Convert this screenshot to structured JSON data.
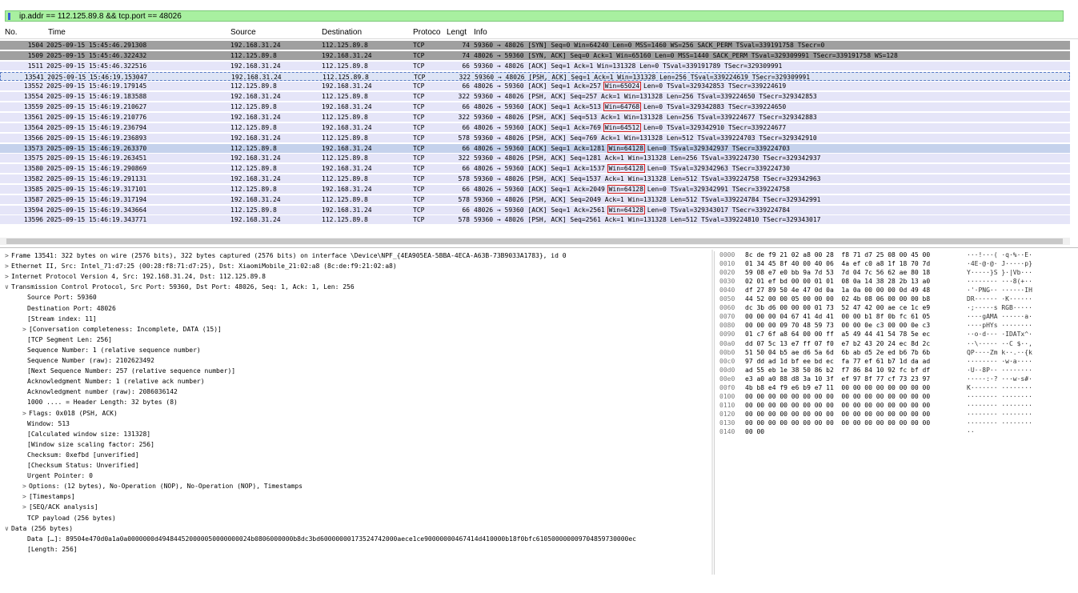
{
  "filter": {
    "value": "ip.addr == 112.125.89.8 && tcp.port == 48026"
  },
  "columns": [
    "No.",
    "Time",
    "Source",
    "Destination",
    "Protoco",
    "Lengt",
    "Info"
  ],
  "packets": [
    {
      "no": "1504",
      "time": "2025-09-15 15:45:46.291308",
      "src": "192.168.31.24",
      "dst": "112.125.89.8",
      "proto": "TCP",
      "len": "74",
      "info_pre": "59360 → 48026 [SYN] Seq=0 Win=64240 Len=0 MSS=1460 WS=256 SACK_PERM TSval=339191758 TSecr=0",
      "win": "",
      "info_post": "",
      "style": "gray"
    },
    {
      "no": "1509",
      "time": "2025-09-15 15:45:46.322432",
      "src": "112.125.89.8",
      "dst": "192.168.31.24",
      "proto": "TCP",
      "len": "74",
      "info_pre": "48026 → 59360 [SYN, ACK] Seq=0 Ack=1 Win=65160 Len=0 MSS=1440 SACK_PERM TSval=329309991 TSecr=339191758 WS=128",
      "win": "",
      "info_post": "",
      "style": "gray"
    },
    {
      "no": "1511",
      "time": "2025-09-15 15:45:46.322516",
      "src": "192.168.31.24",
      "dst": "112.125.89.8",
      "proto": "TCP",
      "len": "66",
      "info_pre": "59360 → 48026 [ACK] Seq=1 Ack=1 Win=131328 Len=0 TSval=339191789 TSecr=329309991",
      "win": "",
      "info_post": "",
      "style": "lav"
    },
    {
      "no": "13541",
      "time": "2025-09-15 15:46:19.153047",
      "src": "192.168.31.24",
      "dst": "112.125.89.8",
      "proto": "TCP",
      "len": "322",
      "info_pre": "59360 → 48026 [PSH, ACK] Seq=1 Ack=1 Win=131328 Len=256 TSval=339224619 TSecr=329309991",
      "win": "",
      "info_post": "",
      "style": "cur"
    },
    {
      "no": "13552",
      "time": "2025-09-15 15:46:19.179145",
      "src": "112.125.89.8",
      "dst": "192.168.31.24",
      "proto": "TCP",
      "len": "66",
      "info_pre": "48026 → 59360 [ACK] Seq=1 Ack=257 ",
      "win": "Win=65024",
      "info_post": " Len=0 TSval=329342853 TSecr=339224619",
      "style": "lav"
    },
    {
      "no": "13554",
      "time": "2025-09-15 15:46:19.183588",
      "src": "192.168.31.24",
      "dst": "112.125.89.8",
      "proto": "TCP",
      "len": "322",
      "info_pre": "59360 → 48026 [PSH, ACK] Seq=257 Ack=1 Win=131328 Len=256 TSval=339224650 TSecr=329342853",
      "win": "",
      "info_post": "",
      "style": "lav"
    },
    {
      "no": "13559",
      "time": "2025-09-15 15:46:19.210627",
      "src": "112.125.89.8",
      "dst": "192.168.31.24",
      "proto": "TCP",
      "len": "66",
      "info_pre": "48026 → 59360 [ACK] Seq=1 Ack=513 ",
      "win": "Win=64768",
      "info_post": " Len=0 TSval=329342883 TSecr=339224650",
      "style": "lav"
    },
    {
      "no": "13561",
      "time": "2025-09-15 15:46:19.210776",
      "src": "192.168.31.24",
      "dst": "112.125.89.8",
      "proto": "TCP",
      "len": "322",
      "info_pre": "59360 → 48026 [PSH, ACK] Seq=513 Ack=1 Win=131328 Len=256 TSval=339224677 TSecr=329342883",
      "win": "",
      "info_post": "",
      "style": "lav"
    },
    {
      "no": "13564",
      "time": "2025-09-15 15:46:19.236794",
      "src": "112.125.89.8",
      "dst": "192.168.31.24",
      "proto": "TCP",
      "len": "66",
      "info_pre": "48026 → 59360 [ACK] Seq=1 Ack=769 ",
      "win": "Win=64512",
      "info_post": " Len=0 TSval=329342910 TSecr=339224677",
      "style": "lav"
    },
    {
      "no": "13566",
      "time": "2025-09-15 15:46:19.236893",
      "src": "192.168.31.24",
      "dst": "112.125.89.8",
      "proto": "TCP",
      "len": "578",
      "info_pre": "59360 → 48026 [PSH, ACK] Seq=769 Ack=1 Win=131328 Len=512 TSval=339224703 TSecr=329342910",
      "win": "",
      "info_post": "",
      "style": "lav"
    },
    {
      "no": "13573",
      "time": "2025-09-15 15:46:19.263370",
      "src": "112.125.89.8",
      "dst": "192.168.31.24",
      "proto": "TCP",
      "len": "66",
      "info_pre": "48026 → 59360 [ACK] Seq=1 Ack=1281 ",
      "win": "Win=64128",
      "info_post": " Len=0 TSval=329342937 TSecr=339224703",
      "style": "sel"
    },
    {
      "no": "13575",
      "time": "2025-09-15 15:46:19.263451",
      "src": "192.168.31.24",
      "dst": "112.125.89.8",
      "proto": "TCP",
      "len": "322",
      "info_pre": "59360 → 48026 [PSH, ACK] Seq=1281 Ack=1 Win=131328 Len=256 TSval=339224730 TSecr=329342937",
      "win": "",
      "info_post": "",
      "style": "lav"
    },
    {
      "no": "13580",
      "time": "2025-09-15 15:46:19.290869",
      "src": "112.125.89.8",
      "dst": "192.168.31.24",
      "proto": "TCP",
      "len": "66",
      "info_pre": "48026 → 59360 [ACK] Seq=1 Ack=1537 ",
      "win": "Win=64128",
      "info_post": " Len=0 TSval=329342963 TSecr=339224730",
      "style": "lav"
    },
    {
      "no": "13582",
      "time": "2025-09-15 15:46:19.291131",
      "src": "192.168.31.24",
      "dst": "112.125.89.8",
      "proto": "TCP",
      "len": "578",
      "info_pre": "59360 → 48026 [PSH, ACK] Seq=1537 Ack=1 Win=131328 Len=512 TSval=339224758 TSecr=329342963",
      "win": "",
      "info_post": "",
      "style": "lav"
    },
    {
      "no": "13585",
      "time": "2025-09-15 15:46:19.317101",
      "src": "112.125.89.8",
      "dst": "192.168.31.24",
      "proto": "TCP",
      "len": "66",
      "info_pre": "48026 → 59360 [ACK] Seq=1 Ack=2049 ",
      "win": "Win=64128",
      "info_post": " Len=0 TSval=329342991 TSecr=339224758",
      "style": "lav"
    },
    {
      "no": "13587",
      "time": "2025-09-15 15:46:19.317194",
      "src": "192.168.31.24",
      "dst": "112.125.89.8",
      "proto": "TCP",
      "len": "578",
      "info_pre": "59360 → 48026 [PSH, ACK] Seq=2049 Ack=1 Win=131328 Len=512 TSval=339224784 TSecr=329342991",
      "win": "",
      "info_post": "",
      "style": "lav"
    },
    {
      "no": "13594",
      "time": "2025-09-15 15:46:19.343664",
      "src": "112.125.89.8",
      "dst": "192.168.31.24",
      "proto": "TCP",
      "len": "66",
      "info_pre": "48026 → 59360 [ACK] Seq=1 Ack=2561 ",
      "win": "Win=64128",
      "info_post": " Len=0 TSval=329343017 TSecr=339224784",
      "style": "lav"
    },
    {
      "no": "13596",
      "time": "2025-09-15 15:46:19.343771",
      "src": "192.168.31.24",
      "dst": "112.125.89.8",
      "proto": "TCP",
      "len": "578",
      "info_pre": "59360 → 48026 [PSH, ACK] Seq=2561 Ack=1 Win=131328 Len=512 TSval=339224810 TSecr=329343017",
      "win": "",
      "info_post": "",
      "style": "lav"
    }
  ],
  "details": [
    {
      "arrow": ">",
      "indent": 0,
      "text": "Frame 13541: 322 bytes on wire (2576 bits), 322 bytes captured (2576 bits) on interface \\Device\\NPF_{4EA905EA-5BBA-4ECA-A63B-73B9033A1783}, id 0"
    },
    {
      "arrow": ">",
      "indent": 0,
      "text": "Ethernet II, Src: Intel_71:d7:25 (00:28:f8:71:d7:25), Dst: XiaomiMobile_21:02:a8 (8c:de:f9:21:02:a8)"
    },
    {
      "arrow": ">",
      "indent": 0,
      "text": "Internet Protocol Version 4, Src: 192.168.31.24, Dst: 112.125.89.8"
    },
    {
      "arrow": "∨",
      "indent": 0,
      "text": "Transmission Control Protocol, Src Port: 59360, Dst Port: 48026, Seq: 1, Ack: 1, Len: 256"
    },
    {
      "arrow": "",
      "indent": 1,
      "text": "Source Port: 59360"
    },
    {
      "arrow": "",
      "indent": 1,
      "text": "Destination Port: 48026"
    },
    {
      "arrow": "",
      "indent": 1,
      "text": "[Stream index: 11]"
    },
    {
      "arrow": ">",
      "indent": 1,
      "text": "[Conversation completeness: Incomplete, DATA (15)]"
    },
    {
      "arrow": "",
      "indent": 1,
      "text": "[TCP Segment Len: 256]"
    },
    {
      "arrow": "",
      "indent": 1,
      "text": "Sequence Number: 1    (relative sequence number)"
    },
    {
      "arrow": "",
      "indent": 1,
      "text": "Sequence Number (raw): 2102623492"
    },
    {
      "arrow": "",
      "indent": 1,
      "text": "[Next Sequence Number: 257    (relative sequence number)]"
    },
    {
      "arrow": "",
      "indent": 1,
      "text": "Acknowledgment Number: 1    (relative ack number)"
    },
    {
      "arrow": "",
      "indent": 1,
      "text": "Acknowledgment number (raw): 2086036142"
    },
    {
      "arrow": "",
      "indent": 1,
      "text": "1000 .... = Header Length: 32 bytes (8)"
    },
    {
      "arrow": ">",
      "indent": 1,
      "text": "Flags: 0x018 (PSH, ACK)"
    },
    {
      "arrow": "",
      "indent": 1,
      "text": "Window: 513"
    },
    {
      "arrow": "",
      "indent": 1,
      "text": "[Calculated window size: 131328]"
    },
    {
      "arrow": "",
      "indent": 1,
      "text": "[Window size scaling factor: 256]"
    },
    {
      "arrow": "",
      "indent": 1,
      "text": "Checksum: 0xefbd [unverified]"
    },
    {
      "arrow": "",
      "indent": 1,
      "text": "[Checksum Status: Unverified]"
    },
    {
      "arrow": "",
      "indent": 1,
      "text": "Urgent Pointer: 0"
    },
    {
      "arrow": ">",
      "indent": 1,
      "text": "Options: (12 bytes), No-Operation (NOP), No-Operation (NOP), Timestamps"
    },
    {
      "arrow": ">",
      "indent": 1,
      "text": "[Timestamps]"
    },
    {
      "arrow": ">",
      "indent": 1,
      "text": "[SEQ/ACK analysis]"
    },
    {
      "arrow": "",
      "indent": 1,
      "text": "TCP payload (256 bytes)"
    },
    {
      "arrow": "∨",
      "indent": 0,
      "text": "Data (256 bytes)"
    },
    {
      "arrow": "",
      "indent": 1,
      "text": "Data […]: 89504e470d0a1a0a0000000d494844520000050000000024b0806000000b8dc3bd60000000173524742000aece1ce90000000467414d410000b18f0bfc610500000009704859730000ec"
    },
    {
      "arrow": "",
      "indent": 1,
      "text": "[Length: 256]"
    }
  ],
  "hex": [
    {
      "off": "0000",
      "hx": "8c de f9 21 02 a8 00 28  f8 71 d7 25 08 00 45 00",
      "asc": "···!···( ·q·%··E·"
    },
    {
      "off": "0010",
      "hx": "01 34 45 8f 40 00 40 06  4a ef c0 a8 1f 18 70 7d",
      "asc": "·4E·@·@· J·····p}"
    },
    {
      "off": "0020",
      "hx": "59 08 e7 e0 bb 9a 7d 53  7d 04 7c 56 62 ae 80 18",
      "asc": "Y·····}S }·|Vb···"
    },
    {
      "off": "0030",
      "hx": "02 01 ef bd 00 00 01 01  08 0a 14 38 28 2b 13 a0",
      "asc": "········ ···8(+··"
    },
    {
      "off": "0040",
      "hx": "df 27 89 50 4e 47 0d 0a  1a 0a 00 00 00 0d 49 48",
      "asc": "·'·PNG·· ······IH"
    },
    {
      "off": "0050",
      "hx": "44 52 00 00 05 00 00 00  02 4b 08 06 00 00 00 b8",
      "asc": "DR······ ·K······"
    },
    {
      "off": "0060",
      "hx": "dc 3b d6 00 00 00 01 73  52 47 42 00 ae ce 1c e9",
      "asc": "·;·····s RGB·····"
    },
    {
      "off": "0070",
      "hx": "00 00 00 04 67 41 4d 41  00 00 b1 8f 0b fc 61 05",
      "asc": "····gAMA ······a·"
    },
    {
      "off": "0080",
      "hx": "00 00 00 09 70 48 59 73  00 00 0e c3 00 00 0e c3",
      "asc": "····pHYs ········"
    },
    {
      "off": "0090",
      "hx": "01 c7 6f a8 64 00 00 ff  a5 49 44 41 54 78 5e ec",
      "asc": "··o·d··· ·IDATx^·"
    },
    {
      "off": "00a0",
      "hx": "dd 07 5c 13 e7 ff 07 f0  e7 b2 43 20 24 ec 8d 2c",
      "asc": "··\\····· ··C $··,"
    },
    {
      "off": "00b0",
      "hx": "51 50 04 b5 ae d6 5a 6d  6b ab d5 2e ed b6 7b 6b",
      "asc": "QP····Zm k··.··{k"
    },
    {
      "off": "00c0",
      "hx": "97 dd ad 1d bf ee bd ec  fa 77 ef 61 b7 1d da ad",
      "asc": "········ ·w·a····"
    },
    {
      "off": "00d0",
      "hx": "ad 55 eb 1e 38 50 86 b2  f7 86 84 10 92 fc bf df",
      "asc": "·U··8P·· ········"
    },
    {
      "off": "00e0",
      "hx": "e3 a0 a0 88 d8 3a 10 3f  ef 97 8f 77 cf 73 23 97",
      "asc": "·····:·? ···w·s#·"
    },
    {
      "off": "00f0",
      "hx": "4b b8 e4 f9 e6 b9 e7 11  00 00 00 00 00 00 00 00",
      "asc": "K······· ········"
    },
    {
      "off": "0100",
      "hx": "00 00 00 00 00 00 00 00  00 00 00 00 00 00 00 00",
      "asc": "········ ········"
    },
    {
      "off": "0110",
      "hx": "00 00 00 00 00 00 00 00  00 00 00 00 00 00 00 00",
      "asc": "········ ········"
    },
    {
      "off": "0120",
      "hx": "00 00 00 00 00 00 00 00  00 00 00 00 00 00 00 00",
      "asc": "········ ········"
    },
    {
      "off": "0130",
      "hx": "00 00 00 00 00 00 00 00  00 00 00 00 00 00 00 00",
      "asc": "········ ········"
    },
    {
      "off": "0140",
      "hx": "00 00",
      "asc": "··"
    }
  ]
}
